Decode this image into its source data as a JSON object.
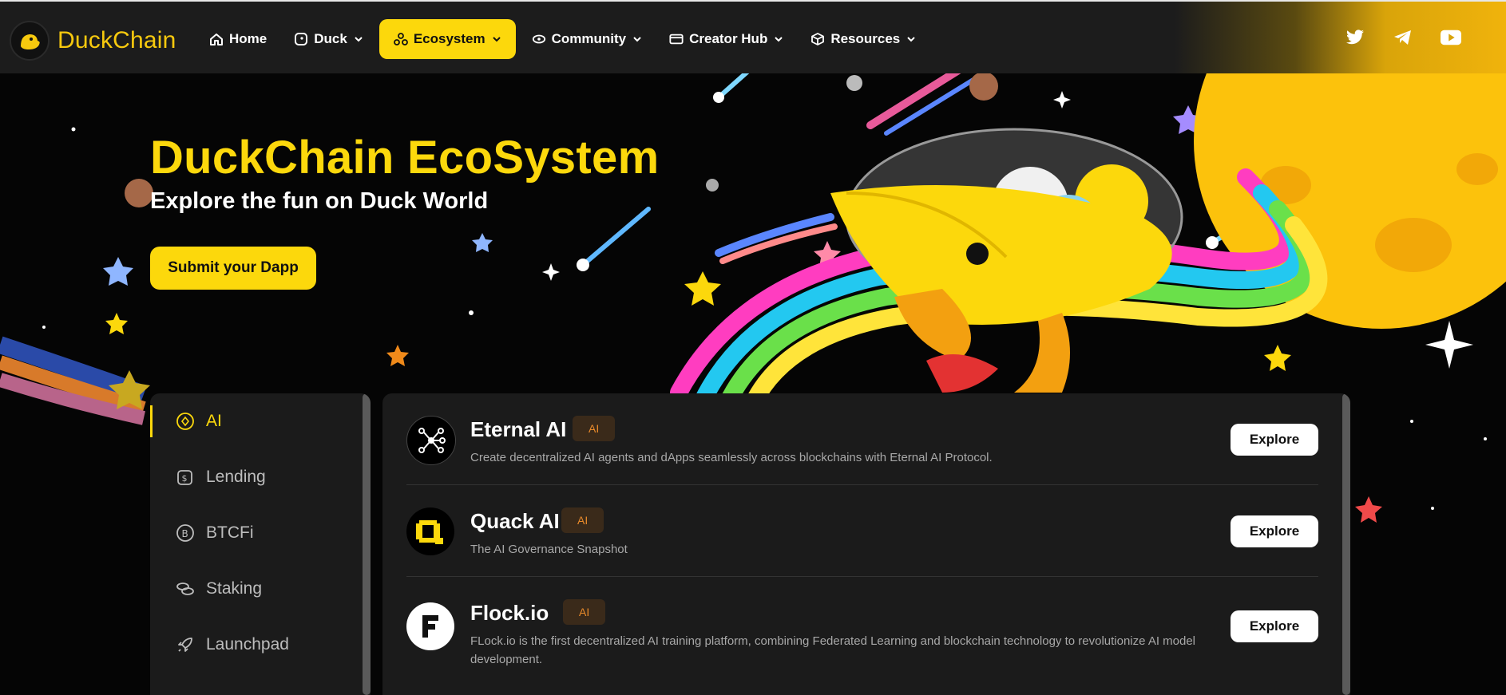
{
  "brand": {
    "name": "DuckChain"
  },
  "nav": {
    "items": [
      {
        "label": "Home",
        "icon": "home-icon",
        "dropdown": false,
        "active": false
      },
      {
        "label": "Duck",
        "icon": "duck-icon",
        "dropdown": true,
        "active": false
      },
      {
        "label": "Ecosystem",
        "icon": "ecosystem-icon",
        "dropdown": true,
        "active": true
      },
      {
        "label": "Community",
        "icon": "community-icon",
        "dropdown": true,
        "active": false
      },
      {
        "label": "Creator Hub",
        "icon": "creator-hub-icon",
        "dropdown": true,
        "active": false
      },
      {
        "label": "Resources",
        "icon": "cube-icon",
        "dropdown": true,
        "active": false
      }
    ]
  },
  "social": [
    "twitter-icon",
    "telegram-icon",
    "youtube-icon"
  ],
  "hero": {
    "title": "DuckChain EcoSystem",
    "subtitle": "Explore the fun on Duck World",
    "cta": "Submit your Dapp"
  },
  "categories": [
    {
      "label": "AI",
      "icon": "ai-icon",
      "active": true
    },
    {
      "label": "Lending",
      "icon": "lending-icon",
      "active": false
    },
    {
      "label": "BTCFi",
      "icon": "bitcoin-icon",
      "active": false
    },
    {
      "label": "Staking",
      "icon": "staking-icon",
      "active": false
    },
    {
      "label": "Launchpad",
      "icon": "rocket-icon",
      "active": false
    }
  ],
  "dapps": [
    {
      "name": "Eternal AI",
      "tag": "AI",
      "description": "Create decentralized AI agents and dApps seamlessly across blockchains with Eternal AI Protocol.",
      "button": "Explore"
    },
    {
      "name": "Quack AI",
      "tag": "AI",
      "description": "The AI Governance Snapshot",
      "button": "Explore"
    },
    {
      "name": "Flock.io",
      "tag": "AI",
      "description": "FLock.io is the first decentralized AI training platform, combining Federated Learning and blockchain technology to revolutionize AI model development.",
      "button": "Explore"
    }
  ],
  "colors": {
    "brand_yellow": "#fcd80c",
    "panel": "#1b1b1b",
    "tag_text": "#e98a2a",
    "background": "#050505"
  }
}
